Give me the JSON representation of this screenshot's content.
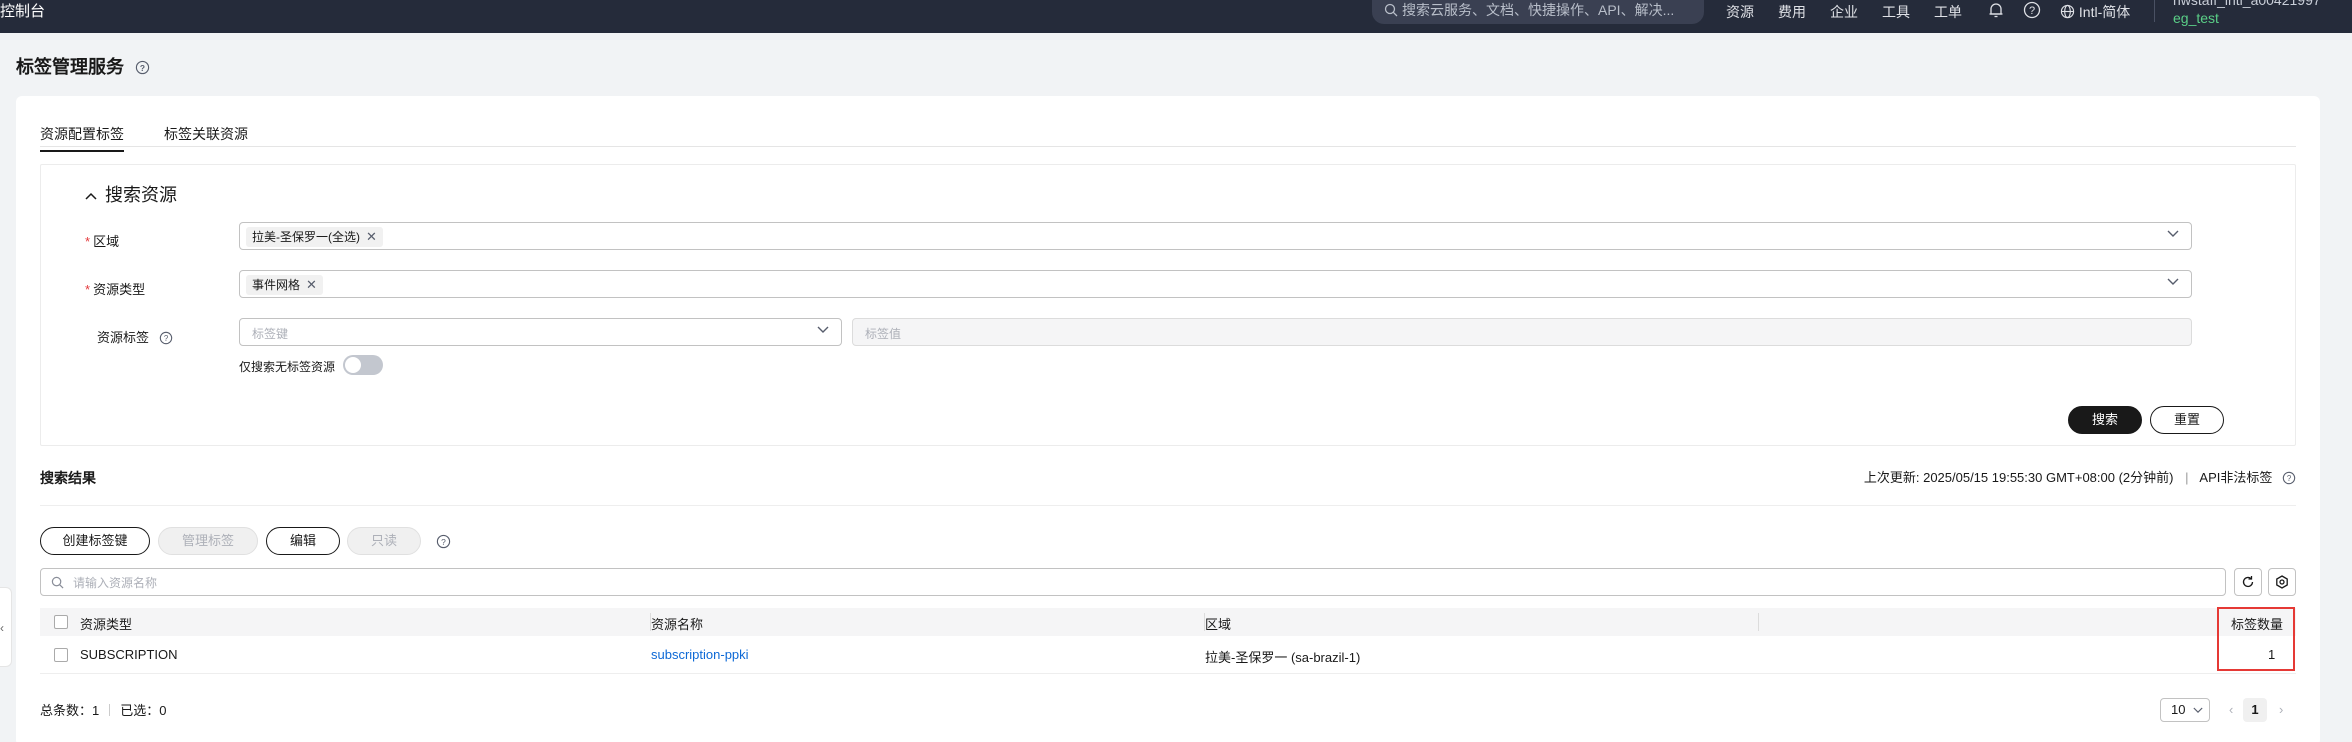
{
  "topbar": {
    "brand": "控制台",
    "search_placeholder": "搜索云服务、文档、快捷操作、API、解决...",
    "nav": [
      "资源",
      "费用",
      "企业",
      "工具",
      "工单"
    ],
    "language": "Intl-简体",
    "user_line1": "hwstaff_intl_a00421997",
    "user_line2": "eg_test"
  },
  "page": {
    "title": "标签管理服务"
  },
  "tabs": [
    "资源配置标签",
    "标签关联资源"
  ],
  "search_panel": {
    "title": "搜索资源",
    "region_label": "区域",
    "region_chip": "拉美-圣保罗一(全选)",
    "type_label": "资源类型",
    "type_chip": "事件网格",
    "tag_label": "资源标签",
    "tag_key_placeholder": "标签键",
    "tag_value_placeholder": "标签值",
    "untagged_only_label": "仅搜索无标签资源",
    "untagged_only_enabled": false,
    "search_button": "搜索",
    "reset_button": "重置"
  },
  "results": {
    "title": "搜索结果",
    "last_update": "上次更新: 2025/05/15 19:55:30 GMT+08:00 (2分钟前)",
    "api_link": "API非法标签",
    "buttons": {
      "create": "创建标签键",
      "manage": "管理标签",
      "edit": "编辑",
      "readonly": "只读"
    },
    "search_placeholder": "请输入资源名称",
    "columns": [
      "资源类型",
      "资源名称",
      "区域",
      "标签数量"
    ],
    "rows": [
      {
        "type": "SUBSCRIPTION",
        "name": "subscription-ppki",
        "region": "拉美-圣保罗一 (sa-brazil-1)",
        "tag_count": "1"
      }
    ],
    "total_label": "总条数：1",
    "selected_label": "已选：0",
    "page_size": "10",
    "current_page": "1"
  },
  "colors": {
    "topbar": "#252b3a",
    "primary": "#191919",
    "link": "#0d69d6",
    "highlight": "#e53935"
  }
}
